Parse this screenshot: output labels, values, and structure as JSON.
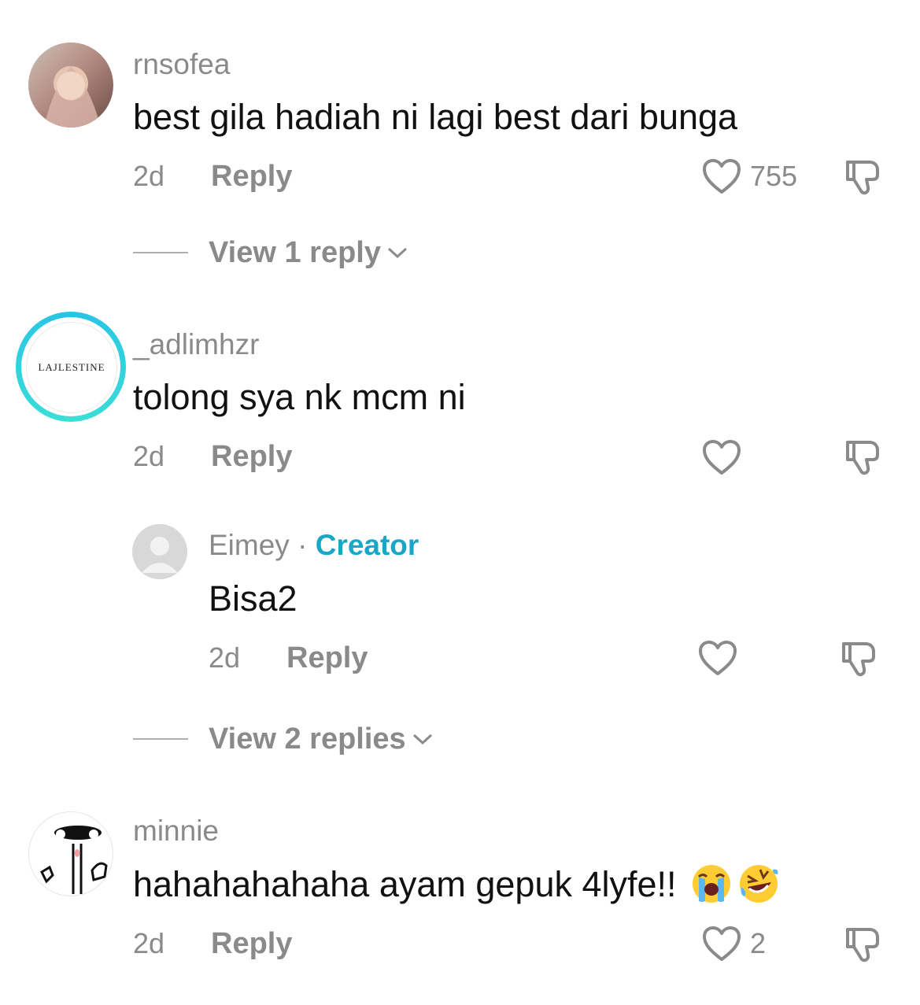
{
  "comments": [
    {
      "username": "rnsofea",
      "text": "best gila hadiah ni lagi best dari bunga",
      "time": "2d",
      "reply_label": "Reply",
      "likes": "755",
      "view_replies": "View 1 reply"
    },
    {
      "username": "_adlimhzr",
      "avatar_text": "LAJLESTINE",
      "text": "tolong sya nk mcm ni",
      "time": "2d",
      "reply_label": "Reply",
      "likes": "",
      "reply": {
        "username": "Eimey",
        "separator": " · ",
        "badge": "Creator",
        "text": "Bisa2",
        "time": "2d",
        "reply_label": "Reply"
      },
      "view_replies": "View 2 replies"
    },
    {
      "username": "minnie",
      "text": "hahahahahaha ayam gepuk 4lyfe!!",
      "emojis": [
        "loudly-crying-face",
        "rolling-on-floor-laughing"
      ],
      "time": "2d",
      "reply_label": "Reply",
      "likes": "2"
    }
  ],
  "colors": {
    "creator": "#1aa6c7",
    "muted": "#8a8a8a",
    "story_ring": "#29c6e8"
  }
}
